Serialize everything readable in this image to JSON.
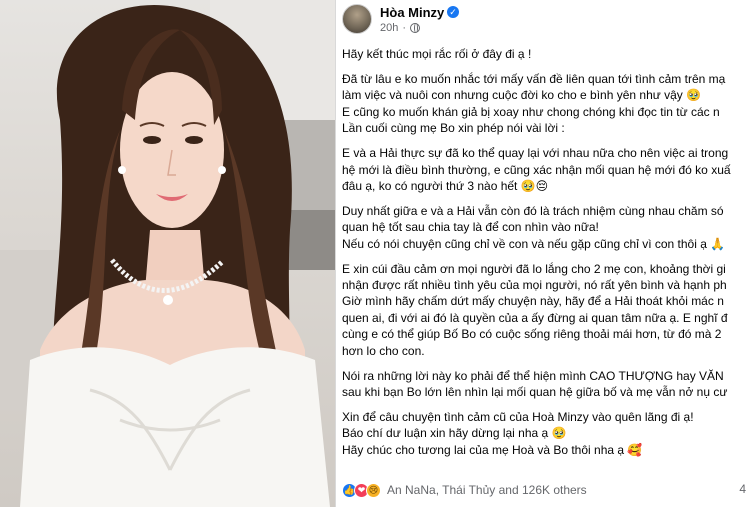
{
  "post": {
    "author": "Hòa Minzy",
    "time": "20h",
    "dot": "·",
    "verified_glyph": "✓",
    "paragraphs": [
      [
        "Hãy kết thúc mọi rắc rối ở đây đi ạ !"
      ],
      [
        "Đã từ lâu e ko muốn nhắc tới mấy vấn đề liên quan tới tình cảm trên mạ",
        "làm việc và nuôi con nhưng cuộc đời ko cho e bình yên như vậy 🥹",
        "E cũng ko muốn khán giả bị xoay như chong chóng khi đọc tin từ các n",
        "Lần cuối cùng mẹ Bo xin phép nói vài lời :"
      ],
      [
        "E và a Hải thực sự đã ko thể quay lại với nhau nữa cho nên việc ai trong",
        "hệ mới là điều bình thường, e cũng xác nhận mối quan hệ mới đó ko xuấ",
        "đâu ạ, ko có người thứ 3 nào hết 🥹😔"
      ],
      [
        "Duy nhất giữa e và a Hải vẫn còn đó là trách nhiệm cùng nhau chăm só",
        "quan hệ tốt sau chia tay là để con nhìn vào nữa!",
        "Nếu có nói chuyện cũng chỉ về con và nếu gặp cũng chỉ vì con thôi ạ 🙏"
      ],
      [
        "E xin cúi đầu cảm ơn mọi người đã lo lắng cho 2 mẹ con, khoảng thời gi",
        "nhận được rất nhiều tình yêu của mọi người, nó rất yên bình và hạnh ph",
        "Giờ mình hãy chấm dứt mấy chuyện này, hãy để a Hải thoát khỏi mác n",
        "quen ai, đi với ai đó là quyền của a ấy đừng ai quan tâm nữa ạ. E nghĩ đ",
        "cùng e có thể giúp Bố Bo có cuộc sống riêng thoải mái hơn, từ đó mà 2",
        "hơn lo cho con."
      ],
      [
        "Nói ra những lời này ko phải để thể hiện mình CAO THƯỢNG hay VĂN",
        "sau khi bạn Bo lớn lên nhìn lại mối quan hệ giữa bố và mẹ vẫn nở nụ cư"
      ],
      [
        "Xin để câu chuyện tình cảm cũ của Hoà Minzy vào quên lãng đi ạ!",
        "Báo chí dư luận xin hãy dừng lại nha ạ 🥹",
        "Hãy chúc cho tương lai của mẹ Hoà và Bo thôi nha ạ 🥰"
      ]
    ],
    "reactions": {
      "like_glyph": "👍",
      "love_glyph": "❤",
      "sad_glyph": "😢",
      "summary": "An NaNa, Thái Thủy and 126K others",
      "comments_partial": "4"
    }
  },
  "colors": {
    "text": "#050505",
    "secondary": "#65676b",
    "brand": "#1877f2"
  }
}
